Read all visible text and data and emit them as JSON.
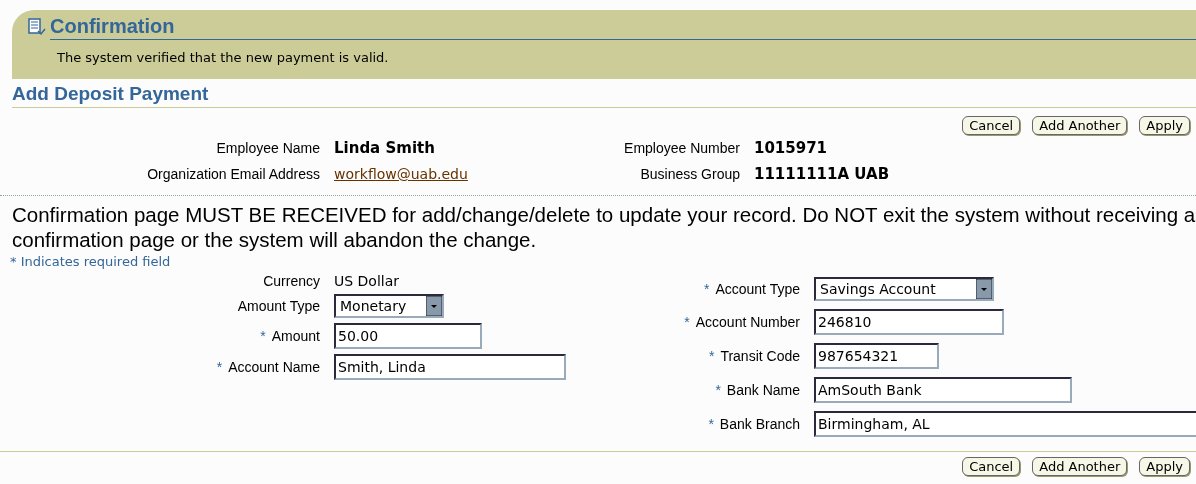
{
  "confirmation": {
    "title": "Confirmation",
    "message": "The system verified that the new payment is valid."
  },
  "page_title": "Add Deposit Payment",
  "buttons_top": [
    "Cancel",
    "Add Another",
    "Apply"
  ],
  "employee_left": [
    {
      "label": "Employee Name",
      "value": "Linda Smith",
      "kind": "bold"
    },
    {
      "label": "Organization Email Address",
      "value": "workflow@uab.edu",
      "kind": "link"
    }
  ],
  "employee_right": [
    {
      "label": "Employee Number",
      "value": "1015971",
      "kind": "bold"
    },
    {
      "label": "Business Group",
      "value": "11111111A UAB",
      "kind": "bold"
    }
  ],
  "notice": "Confirmation page MUST BE RECEIVED for add/change/delete to update your record. Do NOT exit the system without receiving a confirmation page or the system will abandon the change.",
  "required_mark": "*",
  "required_legend": "Indicates required field",
  "fields_left": [
    {
      "label": "Currency",
      "value": "US Dollar",
      "kind": "text",
      "required": false
    },
    {
      "label": "Amount Type",
      "value": "Monetary",
      "kind": "select",
      "required": false
    },
    {
      "label": "Amount",
      "value": "50.00",
      "kind": "input",
      "required": true
    },
    {
      "label": "Account Name",
      "value": "Smith, Linda",
      "kind": "input",
      "required": true
    }
  ],
  "fields_right": [
    {
      "label": "Account Type",
      "value": "Savings Account",
      "kind": "select",
      "required": true
    },
    {
      "label": "Account Number",
      "value": "246810",
      "kind": "input",
      "required": true
    },
    {
      "label": "Transit Code",
      "value": "987654321",
      "kind": "input",
      "required": true
    },
    {
      "label": "Bank Name",
      "value": "AmSouth Bank",
      "kind": "input",
      "required": true
    },
    {
      "label": "Bank Branch",
      "value": "Birmingham, AL",
      "kind": "input",
      "required": true
    }
  ],
  "buttons_bottom": [
    "Cancel",
    "Add Another",
    "Apply"
  ]
}
